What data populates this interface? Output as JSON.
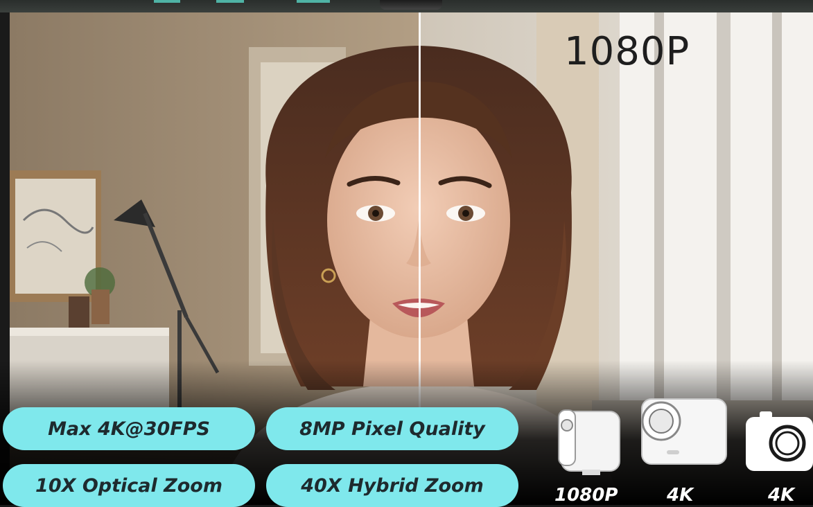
{
  "overlay_resolution_label": "1080P",
  "features": [
    {
      "label": "Max 4K@30FPS"
    },
    {
      "label": "8MP Pixel Quality"
    },
    {
      "label": "10X Optical Zoom"
    },
    {
      "label": "40X Hybrid Zoom"
    }
  ],
  "devices": [
    {
      "icon": "webcam-device-icon",
      "label": "1080P"
    },
    {
      "icon": "camera-device-icon",
      "label": "4K"
    },
    {
      "icon": "photo-camera-icon",
      "label": "4K"
    }
  ],
  "colors": {
    "pill_background": "#7fe8ec",
    "pill_text": "#1e2a2e",
    "accent_teal": "#4fb3a5"
  }
}
